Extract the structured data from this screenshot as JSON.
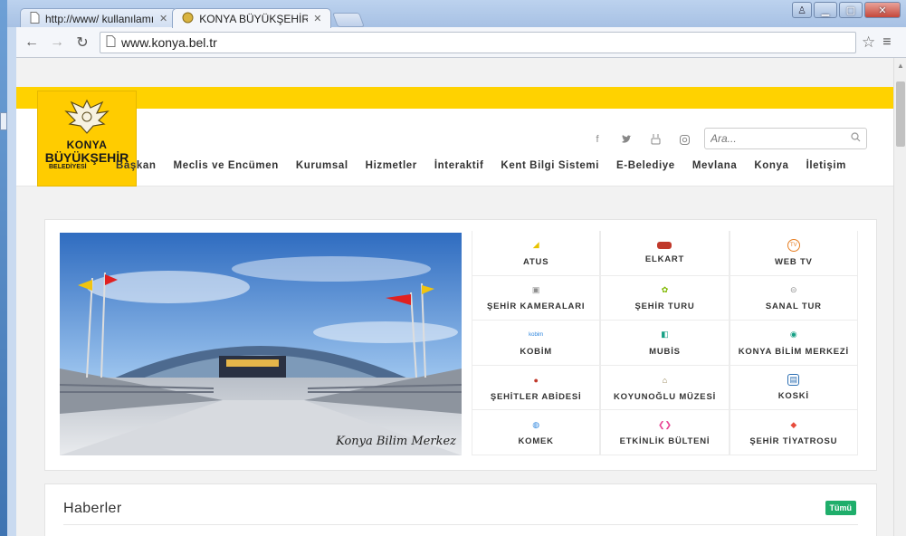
{
  "browser": {
    "tabs": [
      {
        "title": "http://www/ kullanılamıy",
        "active": false
      },
      {
        "title": "KONYA BÜYÜKŞEHİR BELE",
        "active": true
      }
    ],
    "url": "www.konya.bel.tr"
  },
  "site": {
    "logo": {
      "line1": "KONYA",
      "line2": "BÜYÜKŞEHİR",
      "line3": "BELEDİYESİ"
    },
    "search_placeholder": "Ara...",
    "social_icons": [
      "facebook-icon",
      "twitter-icon",
      "youtube-icon",
      "instagram-icon"
    ],
    "nav": [
      "Başkan",
      "Meclis ve Encümen",
      "Kurumsal",
      "Hizmetler",
      "İnteraktif",
      "Kent Bilgi Sistemi",
      "E-Belediye",
      "Mevlana",
      "Konya",
      "İletişim"
    ],
    "hero_caption": "Konya Bilim Merkez",
    "quick_links": [
      {
        "label": "ATUS",
        "icon": "atus-icon",
        "color": "#e8c300"
      },
      {
        "label": "ELKART",
        "icon": "card-icon",
        "color": "#c0392b"
      },
      {
        "label": "WEB TV",
        "icon": "tv-icon",
        "color": "#e67e22"
      },
      {
        "label": "ŞEHİR KAMERALARI",
        "icon": "camera-icon",
        "color": "#8e8e8e"
      },
      {
        "label": "ŞEHİR TURU",
        "icon": "tour-icon",
        "color": "#7fb800"
      },
      {
        "label": "SANAL TUR",
        "icon": "virtual-tour-icon",
        "color": "#8e8e8e"
      },
      {
        "label": "KOBİM",
        "icon": "kobim-icon",
        "color": "#2e86de"
      },
      {
        "label": "MUBİS",
        "icon": "mubis-icon",
        "color": "#16a085"
      },
      {
        "label": "KONYA BİLİM MERKEZİ",
        "icon": "science-center-icon",
        "color": "#16a085"
      },
      {
        "label": "ŞEHİTLER ABİDESİ",
        "icon": "flag-icon",
        "color": "#c0392b"
      },
      {
        "label": "KOYUNOĞLU MÜZESİ",
        "icon": "museum-icon",
        "color": "#8e7a4a"
      },
      {
        "label": "KOSKİ",
        "icon": "koski-icon",
        "color": "#2c6fb3"
      },
      {
        "label": "KOMEK",
        "icon": "globe-icon",
        "color": "#2e86de"
      },
      {
        "label": "ETKİNLİK BÜLTENİ",
        "icon": "events-icon",
        "color": "#e84393"
      },
      {
        "label": "ŞEHİR TİYATROSU",
        "icon": "theater-icon",
        "color": "#e74c3c"
      }
    ],
    "news": {
      "title": "Haberler",
      "badge": "Tümü"
    }
  }
}
